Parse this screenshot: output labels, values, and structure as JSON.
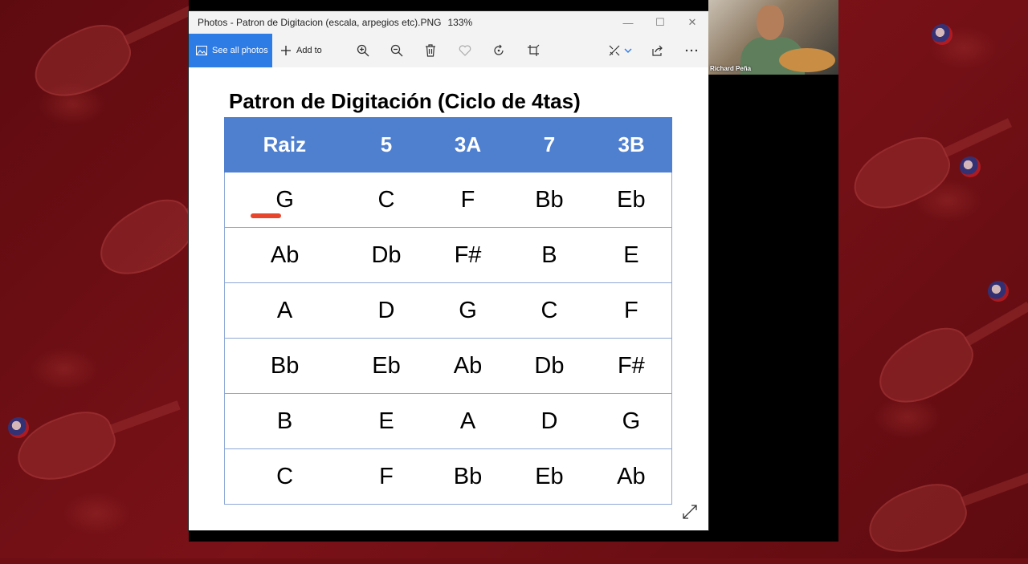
{
  "window": {
    "title": "Photos - Patron de Digitacion (escala, arpegios etc).PNG",
    "zoom": "133%",
    "minimize_glyph": "—",
    "maximize_glyph": "☐",
    "close_glyph": "✕"
  },
  "toolbar": {
    "see_all_label": "See all photos",
    "add_to_label": "Add to",
    "icons": [
      "zoom-in-icon",
      "zoom-out-icon",
      "delete-icon",
      "favorite-icon",
      "rotate-icon",
      "crop-icon",
      "edit-icon",
      "share-icon",
      "more-icon"
    ]
  },
  "document": {
    "title": "Patron de Digitación (Ciclo de 4tas)",
    "headers": [
      "Raiz",
      "5",
      "3A",
      "7",
      "3B"
    ],
    "rows": [
      [
        "G",
        "C",
        "F",
        "Bb",
        "Eb"
      ],
      [
        "Ab",
        "Db",
        "F#",
        "B",
        "E"
      ],
      [
        "A",
        "D",
        "G",
        "C",
        "F"
      ],
      [
        "Bb",
        "Eb",
        "Ab",
        "Db",
        "F#"
      ],
      [
        "B",
        "E",
        "A",
        "D",
        "G"
      ],
      [
        "C",
        "F",
        "Bb",
        "Eb",
        "Ab"
      ]
    ]
  },
  "webcam": {
    "participant_name": "Richard Peña"
  },
  "colors": {
    "accent": "#2d7be5",
    "table_header": "#4f7fcf",
    "underline": "#e8462c",
    "background": "#6e0f14"
  }
}
